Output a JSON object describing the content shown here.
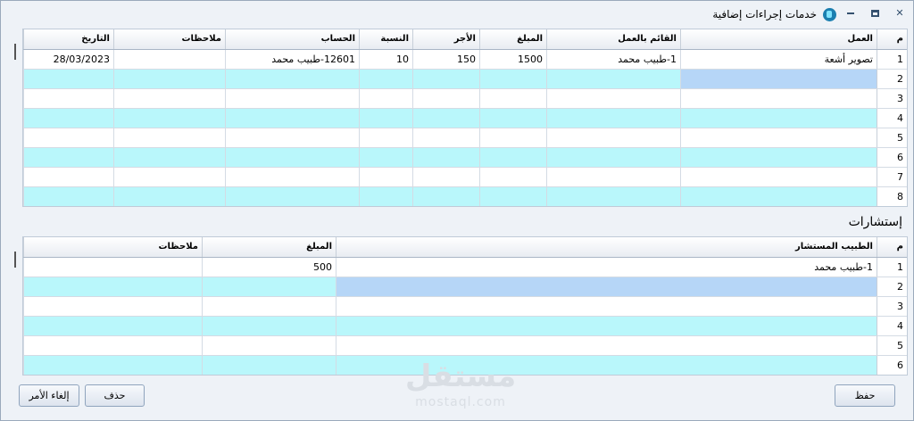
{
  "window": {
    "title": "خدمات إجراءات إضافية"
  },
  "procedures": {
    "columns": [
      "م",
      "العمل",
      "القائم بالعمل",
      "المبلغ",
      "الأجر",
      "النسبة",
      "الحساب",
      "ملاحظات",
      "التاريخ"
    ],
    "rows": [
      [
        "1",
        "تصوير أشعة",
        "1-طبيب محمد",
        "1500",
        "150",
        "10",
        "12601-طبيب محمد",
        "",
        "28/03/2023"
      ],
      [
        "2",
        "",
        "",
        "",
        "",
        "",
        "",
        "",
        ""
      ],
      [
        "3",
        "",
        "",
        "",
        "",
        "",
        "",
        "",
        ""
      ],
      [
        "4",
        "",
        "",
        "",
        "",
        "",
        "",
        "",
        ""
      ],
      [
        "5",
        "",
        "",
        "",
        "",
        "",
        "",
        "",
        ""
      ],
      [
        "6",
        "",
        "",
        "",
        "",
        "",
        "",
        "",
        ""
      ],
      [
        "7",
        "",
        "",
        "",
        "",
        "",
        "",
        "",
        ""
      ],
      [
        "8",
        "",
        "",
        "",
        "",
        "",
        "",
        "",
        ""
      ]
    ]
  },
  "consultations": {
    "label": "إستشارات",
    "columns": [
      "م",
      "الطبيب المستشار",
      "المبلغ",
      "ملاحظات"
    ],
    "rows": [
      [
        "1",
        "1-طبيب محمد",
        "500",
        ""
      ],
      [
        "2",
        "",
        "",
        ""
      ],
      [
        "3",
        "",
        "",
        ""
      ],
      [
        "4",
        "",
        "",
        ""
      ],
      [
        "5",
        "",
        "",
        ""
      ],
      [
        "6",
        "",
        "",
        ""
      ]
    ]
  },
  "buttons": {
    "save": "حفظ",
    "delete": "حذف",
    "cancel": "إلغاء الأمر"
  },
  "watermark": {
    "big": "مستقل",
    "small": "mostaql.com"
  }
}
